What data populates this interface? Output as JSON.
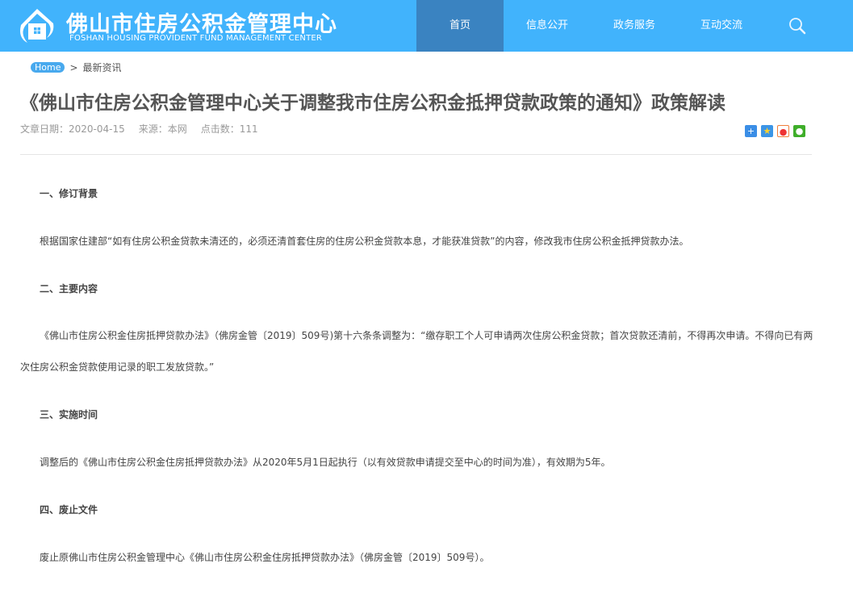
{
  "header": {
    "title": "佛山市住房公积金管理中心",
    "subtitle": "FOSHAN HOUSING PROVIDENT FUND MANAGEMENT CENTER",
    "nav": [
      {
        "label": "首页",
        "active": true
      },
      {
        "label": "信息公开"
      },
      {
        "label": "政务服务"
      },
      {
        "label": "互动交流"
      }
    ],
    "colors": {
      "bg": "#41b3fc",
      "active": "#3a83c1"
    }
  },
  "breadcrumb": {
    "home": "Home",
    "sep": ">",
    "current": "最新资讯"
  },
  "article": {
    "title": "《佛山市住房公积金管理中心关于调整我市住房公积金抵押贷款政策的通知》政策解读",
    "date": "文章日期：2020-04-15",
    "source": "来源：本网",
    "clicks": "点击数：111",
    "paragraphs": [
      {
        "text": "一、修订背景",
        "heading": true
      },
      {
        "text": "根据国家住建部“如有住房公积金贷款未清还的，必须还清首套住房的住房公积金贷款本息，才能获准贷款”的内容，修改我市住房公积金抵押贷款办法。"
      },
      {
        "text": "二、主要内容",
        "heading": true
      },
      {
        "text": "《佛山市住房公积金住房抵押贷款办法》（佛房金管〔2019〕509号)第十六条条调整为：“缴存职工个人可申请两次住房公积金贷款；首次贷款还清前，不得再次申请。不得向已有两次住房公积金贷款使用记录的职工发放贷款。”"
      },
      {
        "text": "三、实施时间",
        "heading": true
      },
      {
        "text": "调整后的《佛山市住房公积金住房抵押贷款办法》从2020年5月1日起执行（以有效贷款申请提交至中心的时间为准），有效期为5年。"
      },
      {
        "text": "四、废止文件",
        "heading": true
      },
      {
        "text": "废止原佛山市住房公积金管理中心《佛山市住房公积金住房抵押贷款办法》（佛房金管〔2019〕509号）。"
      }
    ]
  }
}
